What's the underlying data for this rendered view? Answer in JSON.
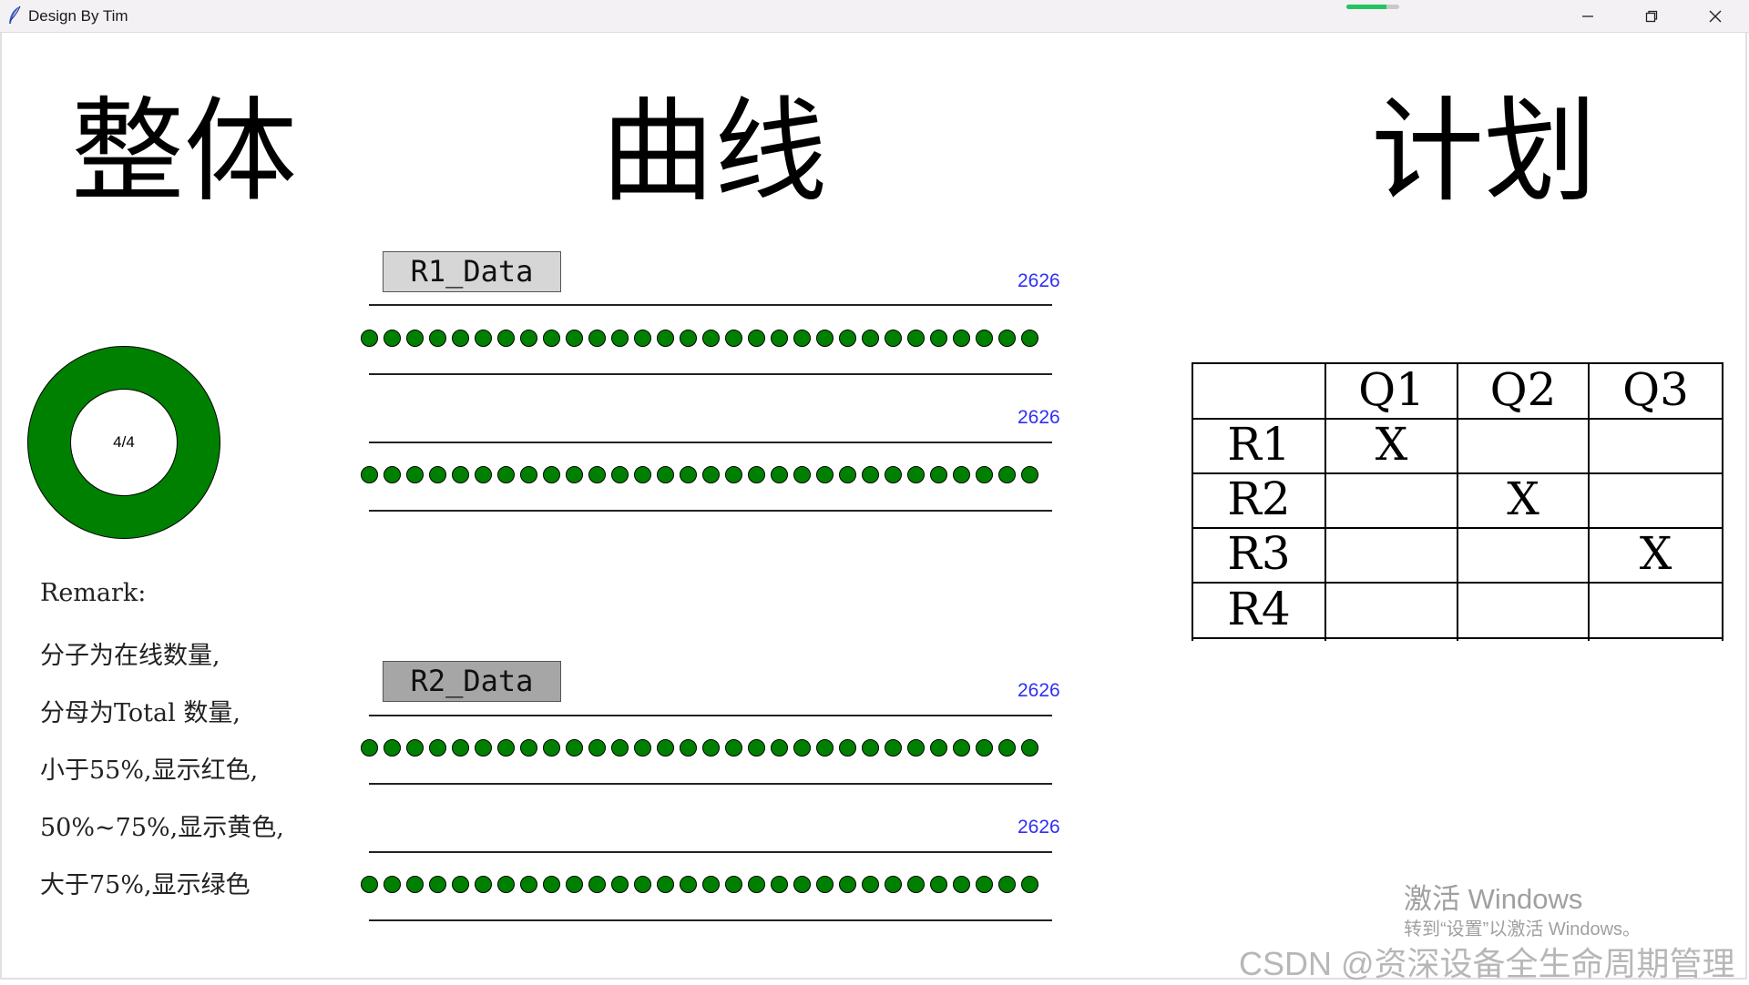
{
  "window": {
    "title": "Design By Tim",
    "app_icon": "feather-icon",
    "progress": 0.75
  },
  "headings": {
    "overall": "整体",
    "curve": "曲线",
    "plan": "计划"
  },
  "overall": {
    "ratio": "4/4",
    "ring_color": "#008000",
    "remarks": [
      "Remark:",
      "分子为在线数量,",
      "分母为Total 数量,",
      "小于55%,显示红色,",
      "50%~75%,显示黄色,",
      "大于75%,显示绿色"
    ]
  },
  "curve": {
    "dot_color": "#008000",
    "dots_per_row": 30,
    "r1_button": "R1_Data",
    "r2_button": "R2_Data",
    "counts": [
      "2626",
      "2626",
      "2626",
      "2626"
    ]
  },
  "plan": {
    "columns": [
      "Q1",
      "Q2",
      "Q3"
    ],
    "rows": [
      {
        "label": "R1",
        "cells": [
          "X",
          "",
          ""
        ]
      },
      {
        "label": "R2",
        "cells": [
          "",
          "X",
          ""
        ]
      },
      {
        "label": "R3",
        "cells": [
          "",
          "",
          "X"
        ]
      },
      {
        "label": "R4",
        "cells": [
          "",
          "",
          ""
        ]
      }
    ]
  },
  "watermark": {
    "activate": "激活 Windows",
    "activate_hint": "转到“设置”以激活 Windows。",
    "csdn": "CSDN @资深设备全生命周期管理"
  }
}
